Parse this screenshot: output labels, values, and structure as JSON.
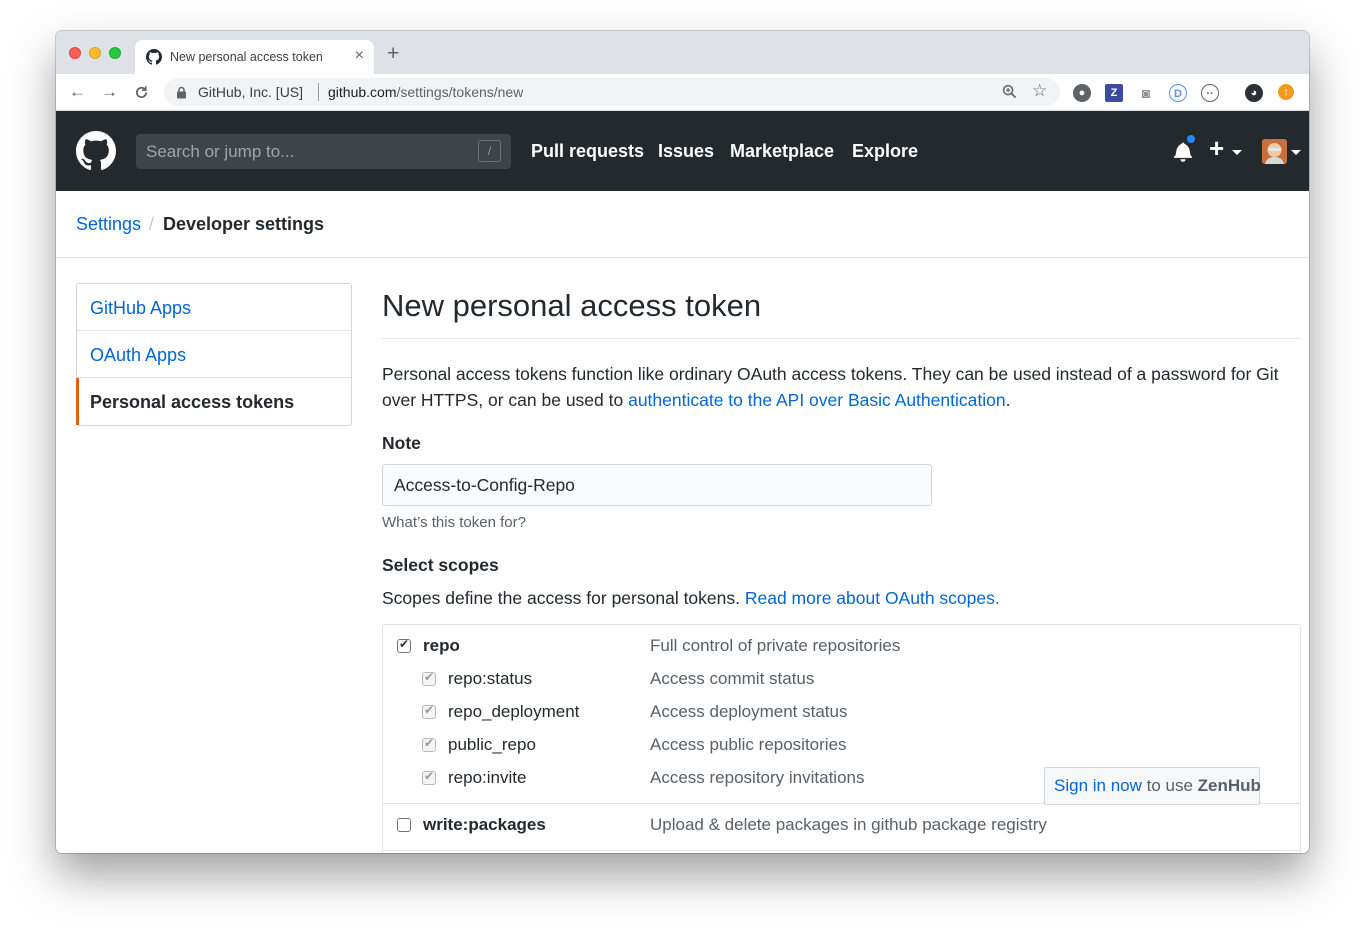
{
  "browser": {
    "tab_title": "New personal access token",
    "tab_close": "×",
    "new_tab": "+",
    "site_identity": "GitHub, Inc. [US]",
    "url_host": "github.com",
    "url_path": "/settings/tokens/new"
  },
  "header": {
    "search_placeholder": "Search or jump to...",
    "search_shortcut": "/",
    "nav": [
      "Pull requests",
      "Issues",
      "Marketplace",
      "Explore"
    ],
    "plus": "+"
  },
  "breadcrumb": {
    "parent": "Settings",
    "separator": "/",
    "current": "Developer settings"
  },
  "sidebar": {
    "items": [
      {
        "label": "GitHub Apps",
        "selected": false
      },
      {
        "label": "OAuth Apps",
        "selected": false
      },
      {
        "label": "Personal access tokens",
        "selected": true
      }
    ]
  },
  "main": {
    "title": "New personal access token",
    "intro_text": "Personal access tokens function like ordinary OAuth access tokens. They can be used instead of a password for Git over HTTPS, or can be used to ",
    "intro_link": "authenticate to the API over Basic Authentication",
    "intro_end": ".",
    "note_label": "Note",
    "note_value": "Access-to-Config-Repo",
    "note_hint": "What’s this token for?",
    "scopes_label": "Select scopes",
    "scopes_text": "Scopes define the access for personal tokens. ",
    "scopes_link": "Read more about OAuth scopes."
  },
  "scopes": [
    {
      "name": "repo",
      "description": "Full control of private repositories",
      "checked": true,
      "level": "top"
    },
    {
      "name": "repo:status",
      "description": "Access commit status",
      "checked": true,
      "level": "sub"
    },
    {
      "name": "repo_deployment",
      "description": "Access deployment status",
      "checked": true,
      "level": "sub"
    },
    {
      "name": "public_repo",
      "description": "Access public repositories",
      "checked": true,
      "level": "sub"
    },
    {
      "name": "repo:invite",
      "description": "Access repository invitations",
      "checked": true,
      "level": "sub"
    },
    {
      "name": "write:packages",
      "description": "Upload & delete packages in github package registry",
      "checked": false,
      "level": "top"
    }
  ],
  "zenhub": {
    "link": "Sign in now",
    "text": " to use ",
    "brand": "ZenHub"
  },
  "colors": {
    "header_bg": "#24292e",
    "link": "#0366d6",
    "selected_accent": "#e36209",
    "notification_dot": "#2188ff"
  }
}
